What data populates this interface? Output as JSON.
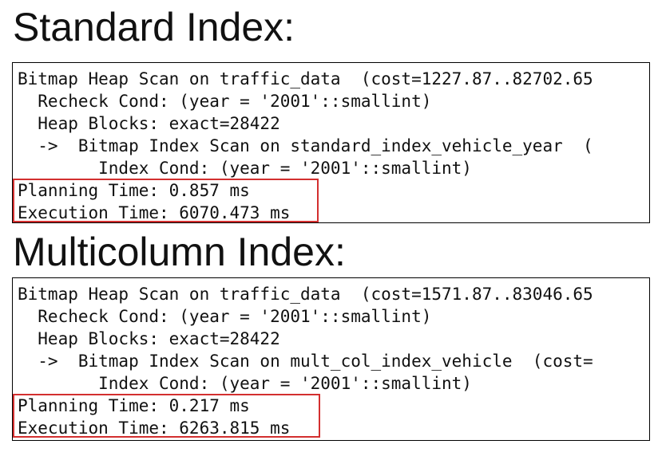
{
  "sections": [
    {
      "heading": "Standard Index:",
      "lines": [
        "Bitmap Heap Scan on traffic_data  (cost=1227.87..82702.65",
        "  Recheck Cond: (year = '2001'::smallint)",
        "  Heap Blocks: exact=28422",
        "  ->  Bitmap Index Scan on standard_index_vehicle_year  (",
        "        Index Cond: (year = '2001'::smallint)",
        "Planning Time: 0.857 ms",
        "Execution Time: 6070.473 ms"
      ]
    },
    {
      "heading": "Multicolumn Index:",
      "lines": [
        "Bitmap Heap Scan on traffic_data  (cost=1571.87..83046.65",
        "  Recheck Cond: (year = '2001'::smallint)",
        "  Heap Blocks: exact=28422",
        "  ->  Bitmap Index Scan on mult_col_index_vehicle  (cost=",
        "        Index Cond: (year = '2001'::smallint)",
        "Planning Time: 0.217 ms",
        "Execution Time: 6263.815 ms"
      ]
    }
  ],
  "colors": {
    "highlight_border": "#d32f2f",
    "panel_border": "#000000",
    "text": "#111111"
  }
}
